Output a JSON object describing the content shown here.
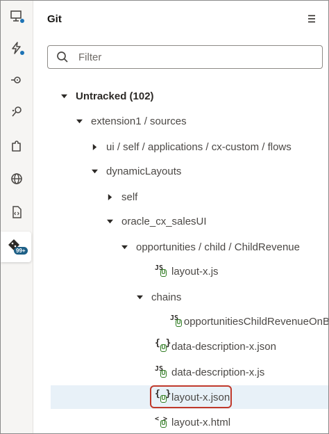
{
  "activity_bar": [
    {
      "name": "designer-icon"
    },
    {
      "name": "events-icon"
    },
    {
      "name": "service-connections-icon"
    },
    {
      "name": "components-icon"
    },
    {
      "name": "extensions-icon"
    },
    {
      "name": "globe-icon"
    },
    {
      "name": "source-code-icon"
    },
    {
      "name": "git-icon",
      "badge": "99+"
    }
  ],
  "panel": {
    "title": "Git",
    "filter_placeholder": "Filter"
  },
  "tree": {
    "untracked": "Untracked (102)",
    "extension": "extension1 / sources",
    "ui_path": "ui / self / applications / cx-custom / flows",
    "dynamic_layouts": "dynamicLayouts",
    "self": "self",
    "oracle_cx": "oracle_cx_salesUI",
    "opportunities": "opportunities / child / ChildRevenue",
    "file_layout_js": "layout-x.js",
    "chains": "chains",
    "file_chain": "opportunitiesChildRevenueOnB",
    "file_data_desc_json": "data-description-x.json",
    "file_data_desc_js": "data-description-x.js",
    "file_layout_json": "layout-x.json",
    "file_layout_html": "layout-x.html",
    "status_letter": "U",
    "js_glyph": "JS",
    "json_glyph": "{ }",
    "html_glyph": "< >"
  },
  "colors": {
    "accent": "#1d73b5",
    "untracked_status": "#2d7a1f",
    "highlight": "#c0392b",
    "selected_row": "#e8f1f8"
  }
}
